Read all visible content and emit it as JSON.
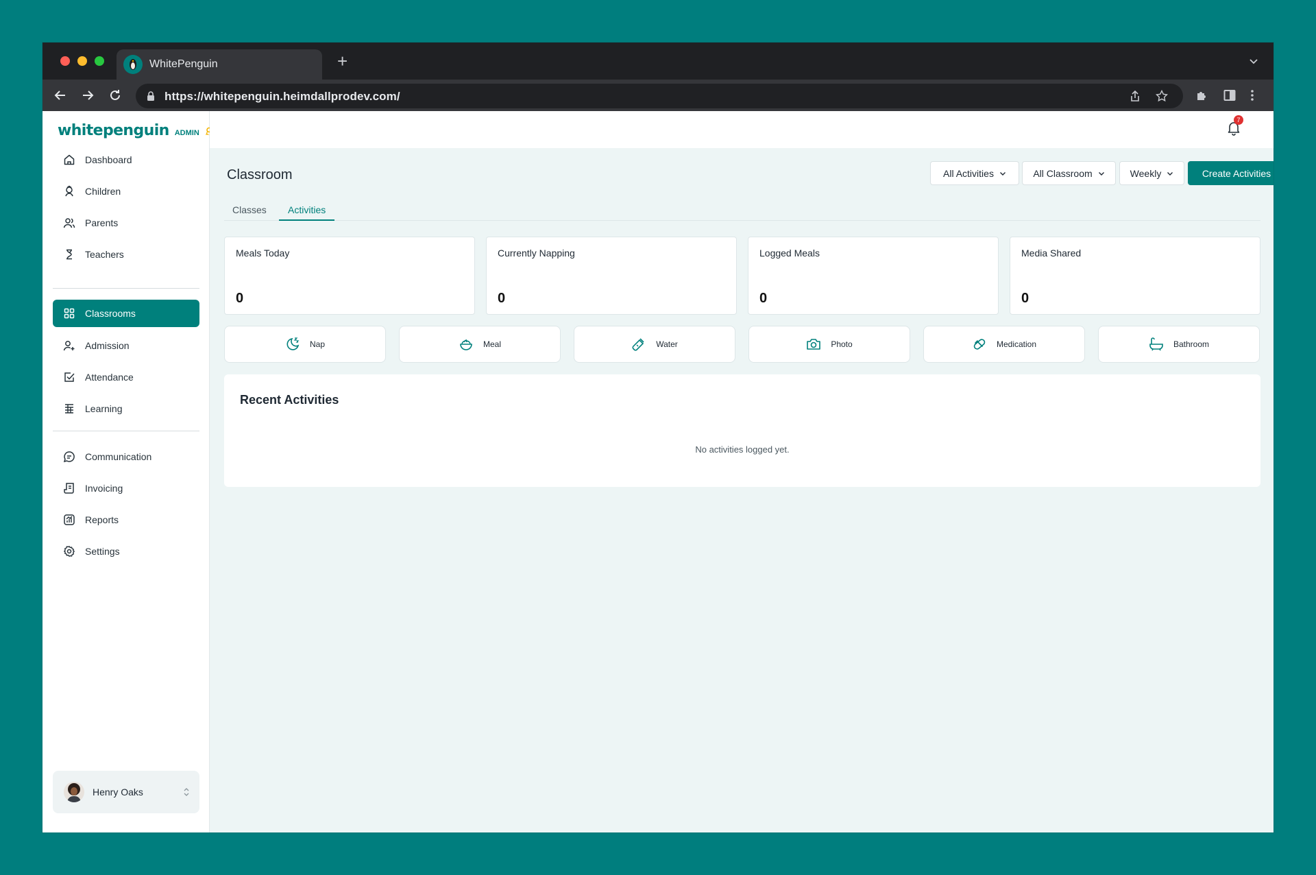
{
  "browser": {
    "tab_title": "WhitePenguin",
    "url": "https://whitepenguin.heimdallprodev.com/"
  },
  "brand": {
    "logo_text": "whitepenguin",
    "badge": "ADMIN",
    "primary_color": "#00807c"
  },
  "sidebar": {
    "group1": [
      {
        "label": "Dashboard",
        "icon": "home-icon"
      },
      {
        "label": "Children",
        "icon": "child-icon"
      },
      {
        "label": "Parents",
        "icon": "users-icon"
      },
      {
        "label": "Teachers",
        "icon": "teacher-icon"
      }
    ],
    "group2": [
      {
        "label": "Classrooms",
        "icon": "grid-icon",
        "active": true
      },
      {
        "label": "Admission",
        "icon": "user-plus-icon"
      },
      {
        "label": "Attendance",
        "icon": "check-square-icon"
      },
      {
        "label": "Learning",
        "icon": "learning-icon"
      }
    ],
    "group3": [
      {
        "label": "Communication",
        "icon": "chat-icon"
      },
      {
        "label": "Invoicing",
        "icon": "invoice-icon"
      },
      {
        "label": "Reports",
        "icon": "chart-icon"
      },
      {
        "label": "Settings",
        "icon": "gear-icon"
      }
    ],
    "user": {
      "name": "Henry Oaks"
    }
  },
  "topbar": {
    "notification_count": "7"
  },
  "main": {
    "title": "Classroom",
    "filters": {
      "activities": "All Activities",
      "classroom": "All Classroom",
      "period": "Weekly"
    },
    "create_button": "Create Activities",
    "tabs": [
      {
        "label": "Classes",
        "active": false
      },
      {
        "label": "Activities",
        "active": true
      }
    ],
    "stats": [
      {
        "label": "Meals Today",
        "value": "0"
      },
      {
        "label": "Currently Napping",
        "value": "0"
      },
      {
        "label": "Logged Meals",
        "value": "0"
      },
      {
        "label": "Media Shared",
        "value": "0"
      }
    ],
    "activity_buttons": [
      {
        "label": "Nap",
        "icon": "nap-icon"
      },
      {
        "label": "Meal",
        "icon": "meal-icon"
      },
      {
        "label": "Water",
        "icon": "water-bottle-icon"
      },
      {
        "label": "Photo",
        "icon": "camera-icon"
      },
      {
        "label": "Medication",
        "icon": "pill-icon"
      },
      {
        "label": "Bathroom",
        "icon": "bathtub-icon"
      }
    ],
    "recent": {
      "title": "Recent Activities",
      "empty_text": "No activities logged yet."
    }
  }
}
